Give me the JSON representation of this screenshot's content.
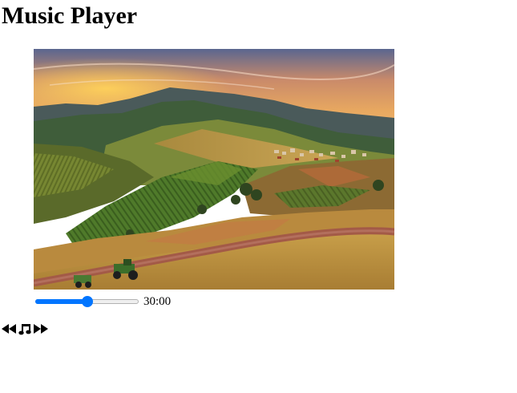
{
  "page": {
    "title": "Music Player"
  },
  "player": {
    "artwork_icon": "landscape-image",
    "progress_fraction": 0.5,
    "time_display": "30:00",
    "accent_color": "#0075ff",
    "controls": [
      {
        "icon": "rewind-icon"
      },
      {
        "icon": "music-note-icon"
      },
      {
        "icon": "fast-forward-icon"
      }
    ]
  }
}
